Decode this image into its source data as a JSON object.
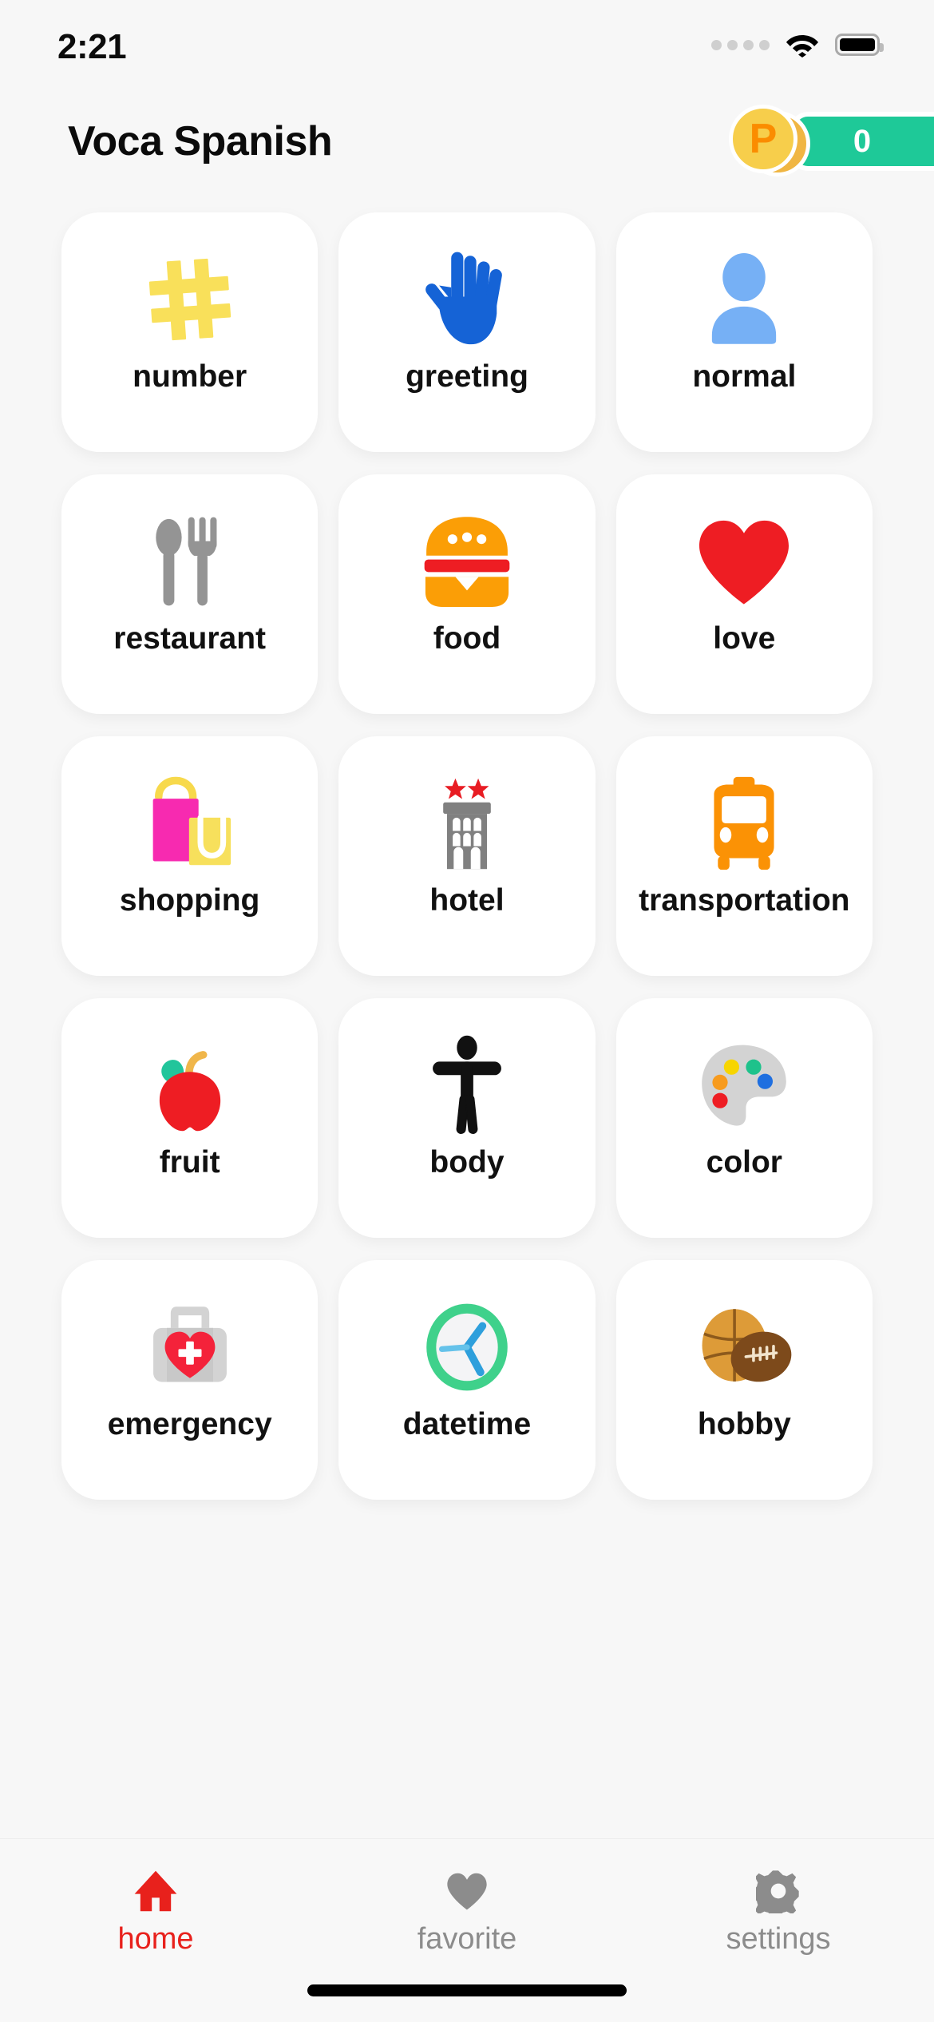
{
  "status_bar": {
    "time": "2:21",
    "cellular_icon": "cellular-dots-icon",
    "wifi_icon": "wifi-icon",
    "battery_icon": "battery-full-icon"
  },
  "header": {
    "app_title": "Voca Spanish",
    "points": {
      "coin_letter": "P",
      "value": "0",
      "coin_color": "#f7ce4b",
      "coin_letter_color": "#fb8c00",
      "pill_color": "#1ec998"
    }
  },
  "grid": {
    "cards": [
      {
        "label": "number",
        "icon": "hash-icon",
        "color": "#f9e05a"
      },
      {
        "label": "greeting",
        "icon": "raised-hand-icon",
        "color": "#1563d6"
      },
      {
        "label": "normal",
        "icon": "person-icon",
        "color": "#76b0f5"
      },
      {
        "label": "restaurant",
        "icon": "fork-spoon-icon",
        "color": "#949494"
      },
      {
        "label": "food",
        "icon": "hamburger-icon",
        "color": "#fb9e06"
      },
      {
        "label": "love",
        "icon": "heart-icon",
        "color": "#ee1d23"
      },
      {
        "label": "shopping",
        "icon": "shopping-bags-icon",
        "color": "#f72ab0"
      },
      {
        "label": "hotel",
        "icon": "hotel-building-icon",
        "color": "#808080"
      },
      {
        "label": "transportation",
        "icon": "bus-icon",
        "color": "#fb9205"
      },
      {
        "label": "fruit",
        "icon": "apple-icon",
        "color": "#ee1d23"
      },
      {
        "label": "body",
        "icon": "body-figure-icon",
        "color": "#111111"
      },
      {
        "label": "color",
        "icon": "palette-icon",
        "color": "#d3d3d3"
      },
      {
        "label": "emergency",
        "icon": "medical-bag-icon",
        "color": "#d3d3d3"
      },
      {
        "label": "datetime",
        "icon": "clock-icon",
        "color": "#3fd18b"
      },
      {
        "label": "hobby",
        "icon": "sports-balls-icon",
        "color": "#d89a3a"
      }
    ]
  },
  "bottom_nav": {
    "items": [
      {
        "label": "home",
        "icon": "home-icon",
        "active": true,
        "color": "#e8211c"
      },
      {
        "label": "favorite",
        "icon": "heart-icon",
        "active": false,
        "color": "#8c8c8c"
      },
      {
        "label": "settings",
        "icon": "gear-icon",
        "active": false,
        "color": "#8c8c8c"
      }
    ]
  }
}
